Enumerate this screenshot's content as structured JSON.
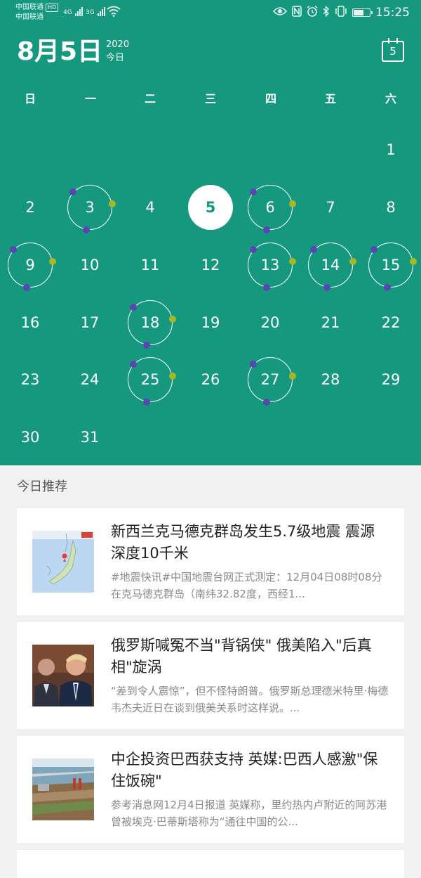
{
  "status_bar": {
    "carrier_top": "中国联通",
    "carrier_hd": "HD",
    "carrier_bottom": "中国联通",
    "net1": "4G",
    "net2": "3G",
    "time": "15:25"
  },
  "header": {
    "date": "8月5日",
    "year": "2020",
    "today_label": "今日",
    "calendar_button_day": "5"
  },
  "weekdays": [
    "日",
    "一",
    "二",
    "三",
    "四",
    "五",
    "六"
  ],
  "calendar": {
    "today": 5,
    "event_days": [
      3,
      6,
      9,
      13,
      14,
      15,
      18,
      25,
      27
    ],
    "days": [
      "1",
      "2",
      "3",
      "4",
      "5",
      "6",
      "7",
      "8",
      "9",
      "10",
      "11",
      "12",
      "13",
      "14",
      "15",
      "16",
      "17",
      "18",
      "19",
      "20",
      "21",
      "22",
      "23",
      "24",
      "25",
      "26",
      "27",
      "28",
      "29",
      "30",
      "31"
    ]
  },
  "recommend": {
    "title": "今日推荐",
    "items": [
      {
        "title": "新西兰克马德克群岛发生5.7级地震 震源深度10千米",
        "summary": "#地震快讯#中国地震台网正式测定：12月04日08时08分在克马德克群岛（南纬32.82度，西经1...",
        "thumb_icon": "earthquake-map-thumbnail"
      },
      {
        "title": "俄罗斯喊冤不当\"背锅侠\" 俄美陷入\"后真相\"旋涡",
        "summary": "“差到令人震惊”，但不怪特朗普。俄罗斯总理德米特里·梅德韦杰夫近日在谈到俄美关系时这样说。...",
        "thumb_icon": "politicians-photo-thumbnail"
      },
      {
        "title": "中企投资巴西获支持 英媒:巴西人感激\"保住饭碗\"",
        "summary": "参考消息网12月4日报道 英媒称，里约热内卢附近的阿苏港曾被埃克·巴蒂斯塔称为“通往中国的公...",
        "thumb_icon": "port-photo-thumbnail"
      }
    ]
  },
  "colors": {
    "primary": "#16987f",
    "event_dot_purple": "#5a46b3",
    "event_dot_olive": "#a6b722"
  }
}
